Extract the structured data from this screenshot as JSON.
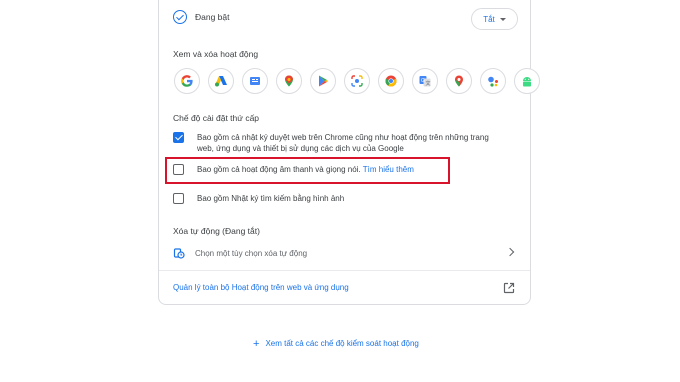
{
  "status": {
    "text": "Đang bật",
    "toggle_label": "Tắt"
  },
  "view_delete": {
    "title": "Xem và xóa hoạt động",
    "apps": [
      {
        "icon": "google-search-icon",
        "color": "#4285f4"
      },
      {
        "icon": "google-ads-icon",
        "color": "#1a73e8"
      },
      {
        "icon": "google-news-icon",
        "color": "#4285f4"
      },
      {
        "icon": "google-maps-pin-icon",
        "color": "#ea4335"
      },
      {
        "icon": "google-play-icon",
        "color": "#34a853"
      },
      {
        "icon": "google-lens-icon",
        "color": "#4285f4"
      },
      {
        "icon": "chrome-icon",
        "color": "#fbbc04"
      },
      {
        "icon": "google-translate-icon",
        "color": "#4285f4"
      },
      {
        "icon": "google-maps-icon",
        "color": "#ea4335"
      },
      {
        "icon": "google-assistant-icon",
        "color": "#4285f4"
      },
      {
        "icon": "android-icon",
        "color": "#3ddc84"
      }
    ]
  },
  "settings": {
    "title": "Chế độ cài đặt thứ cấp",
    "opt1_line1": "Bao gồm cả nhật ký duyệt web trên Chrome cũng như hoạt động trên những trang",
    "opt1_line2": "web, ứng dụng và thiết bị sử dụng các dịch vụ của Google",
    "opt2_text": "Bao gồm cả hoạt động âm thanh và giọng nói.",
    "opt2_link": "Tìm hiểu thêm",
    "opt3_text": "Bao gồm Nhật ký tìm kiếm bằng hình ảnh"
  },
  "auto_delete": {
    "title": "Xóa tự động (Đang tắt)",
    "option": "Chọn một tùy chọn xóa tự động"
  },
  "manage_link": "Quản lý toàn bộ Hoạt động trên web và ứng dụng",
  "footer_link": "Xem tất cả các chế độ kiểm soát hoạt động",
  "colors": {
    "accent": "#1a73e8",
    "highlight": "#d8142c"
  }
}
